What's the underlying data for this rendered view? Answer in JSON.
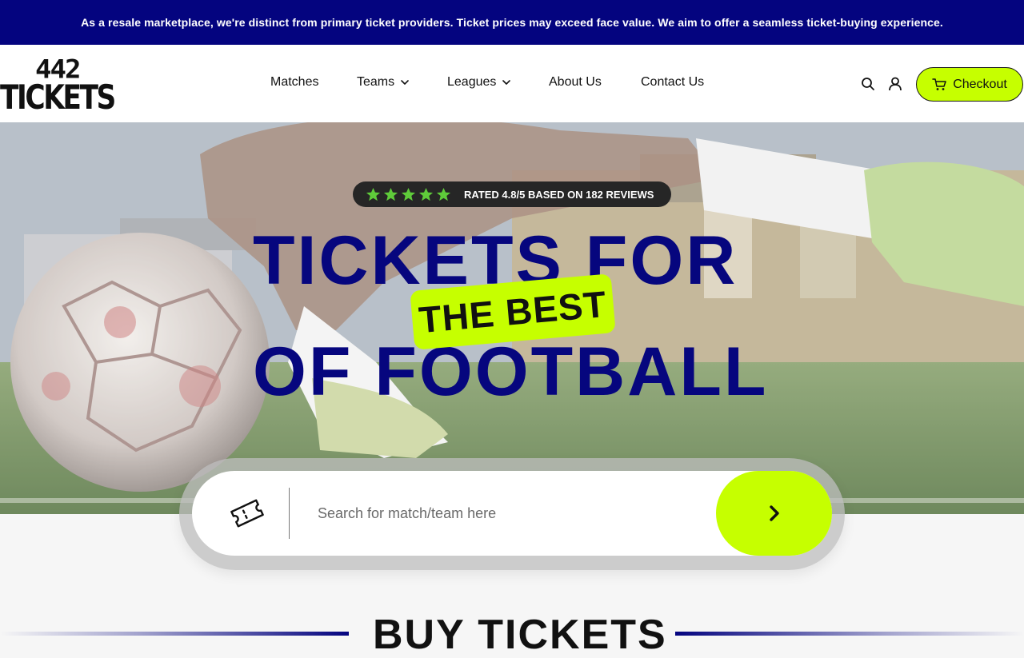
{
  "banner": {
    "text": "As a resale marketplace, we're distinct from primary ticket providers. Ticket prices may exceed face value. We aim to offer a seamless ticket-buying experience."
  },
  "logo": {
    "number": "442",
    "word": "TICKETS"
  },
  "nav": {
    "items": [
      {
        "label": "Matches",
        "has_dropdown": false
      },
      {
        "label": "Teams",
        "has_dropdown": true
      },
      {
        "label": "Leagues",
        "has_dropdown": true
      },
      {
        "label": "About Us",
        "has_dropdown": false
      },
      {
        "label": "Contact Us",
        "has_dropdown": false
      }
    ],
    "icons": [
      "search-icon",
      "user-icon"
    ],
    "checkout_label": "Checkout"
  },
  "hero": {
    "rating": {
      "stars": 5,
      "text": "RATED 4.8/5 BASED ON 182 REVIEWS"
    },
    "headline_line1": "TICKETS FOR",
    "highlight": "THE BEST",
    "headline_line2": "OF FOOTBALL"
  },
  "search": {
    "placeholder": "Search for match/team here",
    "value": ""
  },
  "section": {
    "title": "BUY TICKETS"
  },
  "colors": {
    "brand_navy": "#04047f",
    "accent_lime": "#c6ff00",
    "rating_pill": "#262626",
    "headline": "#06067e"
  }
}
